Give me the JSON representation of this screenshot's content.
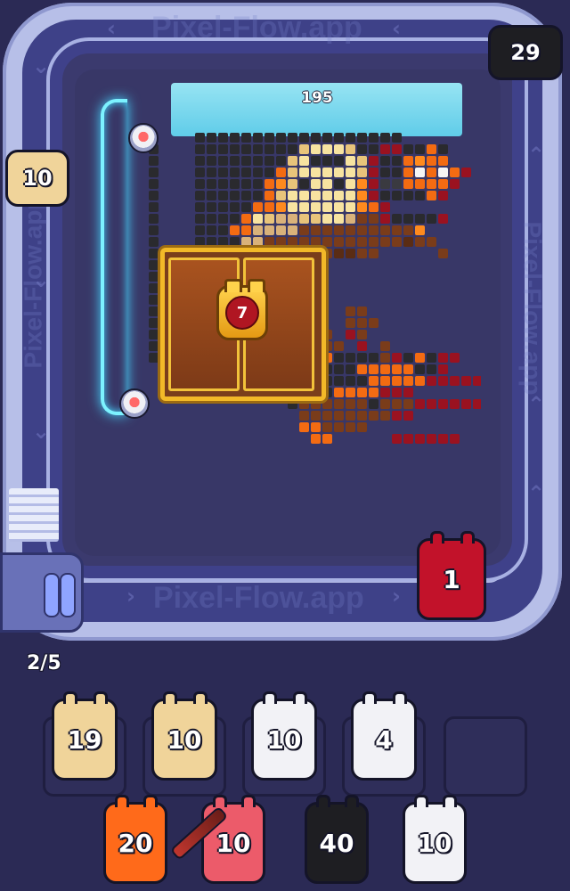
{
  "watermarks": [
    "Pixel-Flow.app",
    "Pixel-flow.app",
    "Pixel-Flow.app",
    "Pixel-Flow.app",
    "Pixel-Flow.app"
  ],
  "board": {
    "remaining_pixels": "195",
    "chest_lock_count": "7"
  },
  "conveyor": {
    "top_right_block": {
      "count": "29",
      "color": "#1e1e22"
    },
    "left_block": {
      "count": "10",
      "color": "#f0d49a"
    },
    "active_block": {
      "count": "1",
      "color": "#c2122a"
    }
  },
  "slots": {
    "progress": "2/5",
    "items": [
      {
        "count": "19",
        "color": "#f0d49a"
      },
      {
        "count": "10",
        "color": "#f0d49a"
      },
      {
        "count": "10",
        "color": "#f2f2f6"
      },
      {
        "count": "4",
        "color": "#f2f2f6"
      },
      {
        "count": "",
        "color": ""
      }
    ]
  },
  "queue": [
    {
      "count": "20",
      "color": "#ff6a1a"
    },
    {
      "count": "10",
      "color": "#ec5b6a"
    },
    {
      "count": "40",
      "color": "#1e1e22"
    },
    {
      "count": "10",
      "color": "#f2f2f6"
    }
  ]
}
